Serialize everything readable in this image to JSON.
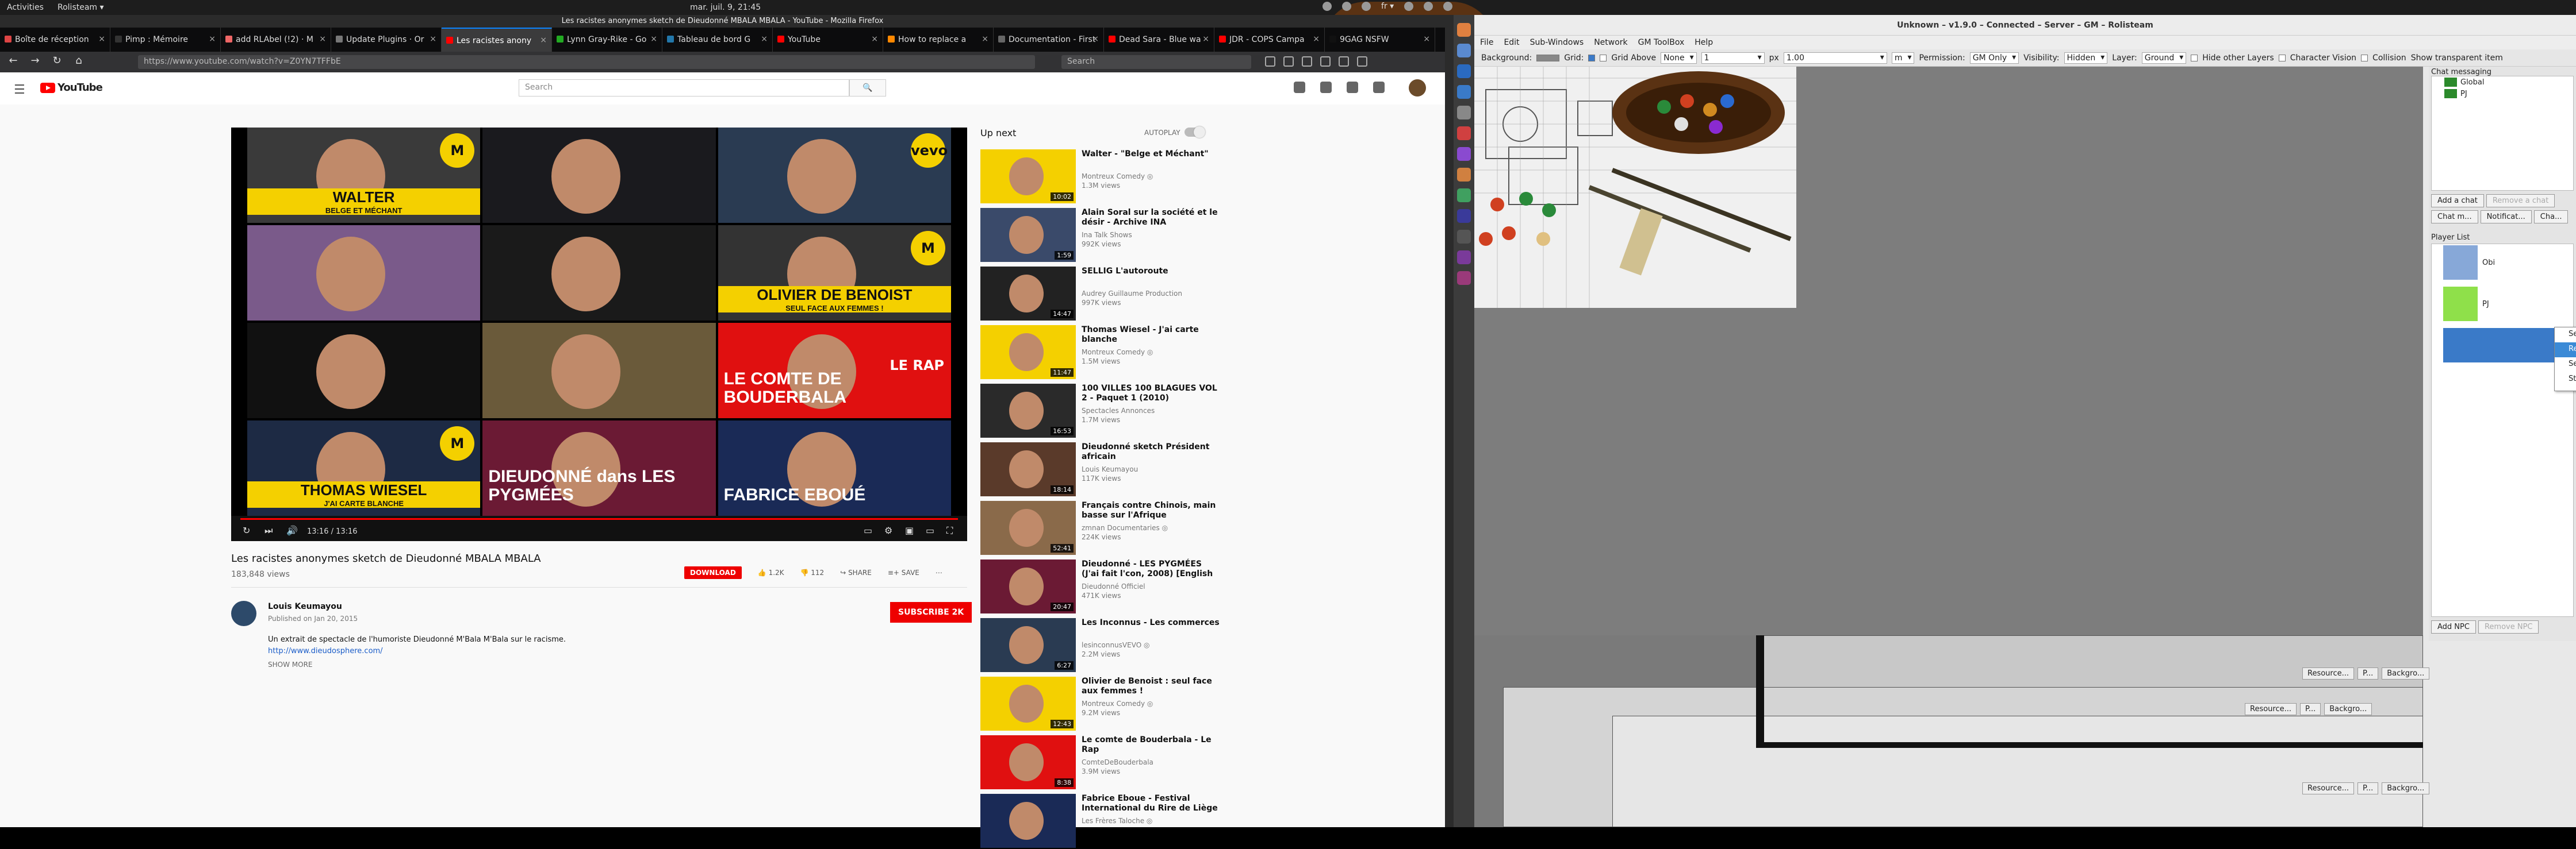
{
  "topbar": {
    "activities": "Activities",
    "app": "Rolisteam ▾",
    "clock": "mar. juil. 9, 21:45",
    "lang": "fr ▾"
  },
  "firefox": {
    "title": "Les racistes anonymes sketch de Dieudonné MBALA MBALA - YouTube - Mozilla Firefox",
    "tabs": [
      {
        "label": "Boîte de réception",
        "color": "#d44"
      },
      {
        "label": "Pimp : Mémoire",
        "color": "#333"
      },
      {
        "label": "add RLAbel (!2) · M",
        "color": "#e66"
      },
      {
        "label": "Update Plugins · Or",
        "color": "#777"
      },
      {
        "label": "Les racistes anony",
        "color": "#f00",
        "active": true
      },
      {
        "label": "Lynn Gray-Rike - Go",
        "color": "#2a2"
      },
      {
        "label": "Tableau de bord G",
        "color": "#27a"
      },
      {
        "label": "YouTube",
        "color": "#f00"
      },
      {
        "label": "How to replace a",
        "color": "#f80"
      },
      {
        "label": "Documentation - First",
        "color": "#666"
      },
      {
        "label": "Dead Sara - Blue wa",
        "color": "#f00"
      },
      {
        "label": "JDR - COPS Campa",
        "color": "#f00"
      },
      {
        "label": "9GAG NSFW",
        "color": "#111"
      }
    ],
    "url": "https://www.youtube.com/watch?v=Z0YN7TFFbE",
    "search_placeholder": "Search"
  },
  "youtube": {
    "search_placeholder": "Search",
    "logo": "YouTube",
    "player": {
      "time": "13:16 / 13:16",
      "tiles": [
        {
          "name": "WALTER",
          "sub": "BELGE ET MÉCHANT",
          "bg": "#3a3a3a",
          "cap": true,
          "badge": "M"
        },
        {
          "name": "",
          "sub": "",
          "bg": "#1a1a1e"
        },
        {
          "name": "",
          "sub": "",
          "bg": "#2a3b52",
          "badge": "vevo"
        },
        {
          "name": "",
          "sub": "",
          "bg": "#7a5a8a"
        },
        {
          "name": "",
          "sub": "",
          "bg": "#1a1a1a"
        },
        {
          "name": "OLIVIER DE BENOIST",
          "sub": "SEUL FACE AUX FEMMES !",
          "bg": "#333",
          "cap": true,
          "badge": "M"
        },
        {
          "name": "",
          "sub": "",
          "bg": "#111"
        },
        {
          "name": "",
          "sub": "",
          "bg": "#6a5a3a"
        },
        {
          "name": "LE COMTE DE BOUDERBALA",
          "sub": "LE RAP",
          "bg": "#e01010"
        },
        {
          "name": "THOMAS WIESEL",
          "sub": "J'AI CARTE BLANCHE",
          "bg": "#1d2a44",
          "cap": true,
          "badge": "M"
        },
        {
          "name": "DIEUDONNÉ dans LES PYGMÉES",
          "sub": "",
          "bg": "#6b1a34"
        },
        {
          "name": "FABRICE EBOUÉ",
          "sub": "",
          "bg": "#1a2a56"
        }
      ]
    },
    "video_title": "Les racistes anonymes sketch de Dieudonné MBALA MBALA",
    "views": "183,848 views",
    "download": "DOWNLOAD",
    "likes": "1.2K",
    "dislikes": "112",
    "share": "SHARE",
    "save": "SAVE",
    "channel": "Louis Keumayou",
    "published": "Published on Jan 20, 2015",
    "subscribe": "SUBSCRIBE 2K",
    "description": "Un extrait de spectacle de l'humoriste Dieudonné M'Bala M'Bala sur le racisme.",
    "desc_link": "http://www.dieudosphere.com/",
    "show_more": "SHOW MORE",
    "up_next": "Up next",
    "autoplay": "AUTOPLAY",
    "recommendations": [
      {
        "title": "Walter - \"Belge et Méchant\"",
        "channel": "Montreux Comedy ◎",
        "views": "1.3M views",
        "dur": "10:02",
        "color": "#f4d000"
      },
      {
        "title": "Alain Soral sur la société et le désir - Archive INA",
        "channel": "Ina Talk Shows",
        "views": "992K views",
        "dur": "1:59",
        "color": "#3a4a6a"
      },
      {
        "title": "SELLIG L'autoroute",
        "channel": "Audrey Guillaume Production",
        "views": "997K views",
        "dur": "14:47",
        "color": "#222"
      },
      {
        "title": "Thomas Wiesel - J'ai carte blanche",
        "channel": "Montreux Comedy ◎",
        "views": "1.5M views",
        "dur": "11:47",
        "color": "#f4d000"
      },
      {
        "title": "100 VILLES 100 BLAGUES VOL 2 - Paquet 1 (2010)",
        "channel": "Spectacles Annonces",
        "views": "1.7M views",
        "dur": "16:53",
        "color": "#2a2a2a"
      },
      {
        "title": "Dieudonné sketch Président africain",
        "channel": "Louis Keumayou",
        "views": "117K views",
        "dur": "18:14",
        "color": "#5a3a2a"
      },
      {
        "title": "Français contre Chinois, main basse sur l'Afrique",
        "channel": "zmnan Documentaries ◎",
        "views": "224K views",
        "dur": "52:41",
        "color": "#8a6a4a"
      },
      {
        "title": "Dieudonné - LES PYGMÉES (J'ai fait l'con, 2008) [English",
        "channel": "Dieudonné Officiel",
        "views": "471K views",
        "dur": "20:47",
        "color": "#6b1a34"
      },
      {
        "title": "Les Inconnus - Les commerces",
        "channel": "lesinconnusVEVO ◎",
        "views": "2.2M views",
        "dur": "6:27",
        "color": "#2a3b52"
      },
      {
        "title": "Olivier de Benoist : seul face aux femmes !",
        "channel": "Montreux Comedy ◎",
        "views": "9.2M views",
        "dur": "12:43",
        "color": "#f4d000"
      },
      {
        "title": "Le comte de Bouderbala - Le Rap",
        "channel": "ComteDeBouderbala",
        "views": "3.9M views",
        "dur": "8:38",
        "color": "#e01010"
      },
      {
        "title": "Fabrice Eboue - Festival International du Rire de Liège",
        "channel": "Les Frères Taloche ◎",
        "views": "",
        "dur": "",
        "color": "#1a2a56"
      }
    ]
  },
  "rolisteam": {
    "title": "Unknown – v1.9.0 – Connected – Server – GM – Rolisteam",
    "menu": [
      "File",
      "Edit",
      "Sub-Windows",
      "Network",
      "GM ToolBox",
      "Help"
    ],
    "toolbar": {
      "background": "Background:",
      "grid": "Grid:",
      "grid_above": "Grid Above",
      "none": "None",
      "size": "1",
      "px": "px",
      "scale": "1.00",
      "unit": "m",
      "permission": "Permission:",
      "perm_val": "GM Only",
      "visibility": "Visibility:",
      "vis_val": "Hidden",
      "layer": "Layer:",
      "layer_val": "Ground",
      "hide_layers": "Hide other Layers",
      "char_vision": "Character Vision",
      "collision": "Collision",
      "transparent": "Show transparent item"
    },
    "chat_title": "Chat messaging",
    "chats": [
      {
        "label": "Global",
        "color": "#2b8a2b"
      },
      {
        "label": "PJ",
        "color": "#2b8a2b"
      }
    ],
    "add_chat": "Add a chat",
    "remove_chat": "Remove a chat",
    "chat_tabs": [
      "Chat m...",
      "Notificat...",
      "Cha..."
    ],
    "player_list": "Player List",
    "players": [
      {
        "label": "Obi",
        "color": "#87a8d8"
      },
      {
        "label": "PJ",
        "color": "#8fe04a"
      },
      {
        "label": "",
        "color": "#3a7ac8"
      }
    ],
    "context_menu": [
      "Set Avatar...",
      "Remove Avatar...",
      "Set Property",
      "State"
    ],
    "add_npc": "Add NPC",
    "remove_npc": "Remove NPC",
    "bottom_tabs": [
      "Resource...",
      "P...",
      "Backgro..."
    ]
  }
}
